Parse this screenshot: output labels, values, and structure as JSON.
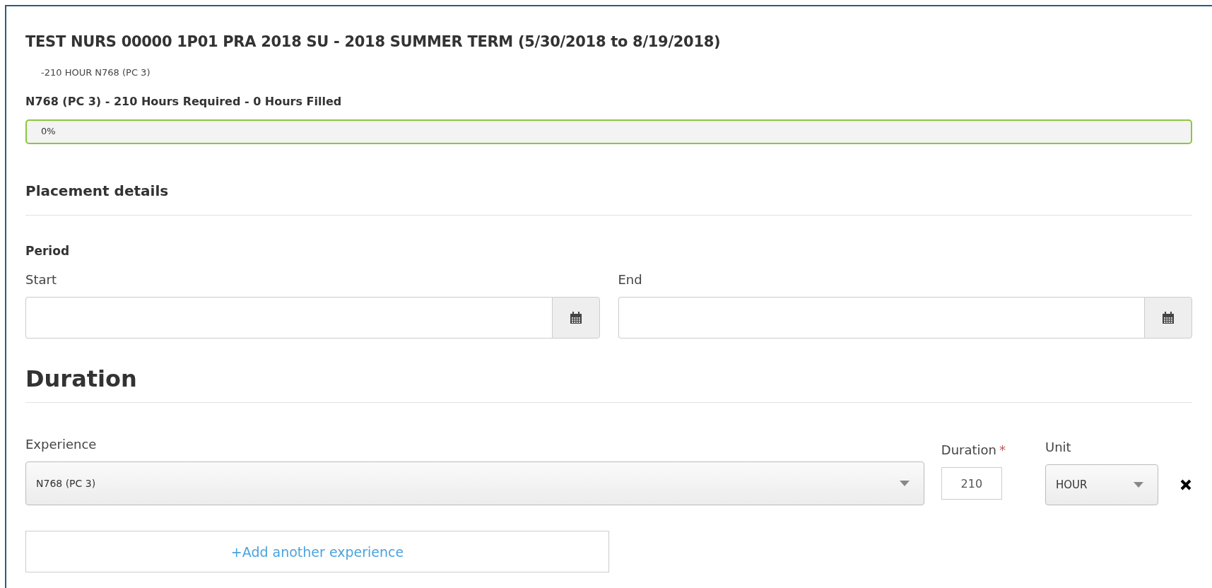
{
  "title": "TEST NURS 00000 1P01 PRA 2018 SU - 2018 SUMMER TERM (5/30/2018 to 8/19/2018)",
  "requirements": [
    "-210 HOUR N768 (PC 3)"
  ],
  "progress": {
    "heading": "N768 (PC 3) - 210 Hours Required - 0 Hours Filled",
    "level": 0,
    "reading": "0%"
  },
  "placement": {
    "heading": "Placement details",
    "period_label": "Period",
    "fields": [
      {
        "label": "Start"
      },
      {
        "label": "End"
      }
    ]
  },
  "duration": {
    "heading": "Duration",
    "experience_label": "Experience",
    "duration_label": "Duration",
    "required_mark": "*",
    "unit_label": "Unit",
    "rows": [
      {
        "experience": "N768 (PC 3)",
        "duration": "210",
        "unit": "HOUR"
      }
    ],
    "add_button": "+Add another experience"
  }
}
